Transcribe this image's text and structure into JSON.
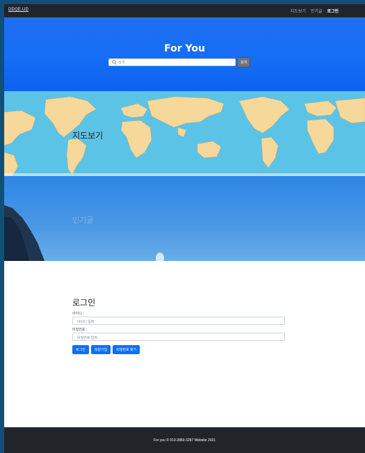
{
  "nav": {
    "brand": "DDQE.UD",
    "links": [
      "지도보기",
      "인기글",
      "로그인"
    ]
  },
  "hero": {
    "title": "For You",
    "search_placeholder": "검색",
    "search_button": "검색"
  },
  "sections": {
    "map_label": "지도보기",
    "popular_label": "인기글"
  },
  "login": {
    "title": "로그인",
    "id_label": "아이디 :",
    "id_placeholder": "아이디 입력",
    "pw_label": "비밀번호 :",
    "pw_placeholder": "비밀번호 입력",
    "buttons": [
      "로그인",
      "회원가입",
      "비밀번호 찾기"
    ]
  },
  "footer": {
    "text": "For you © 010-2860-3287 Website 2021"
  },
  "colors": {
    "navbar": "#212529",
    "hero": "#156ef5",
    "map_ocean": "#5bc3e6",
    "land": "#f6d89a",
    "primary_button": "#0d6efd"
  }
}
